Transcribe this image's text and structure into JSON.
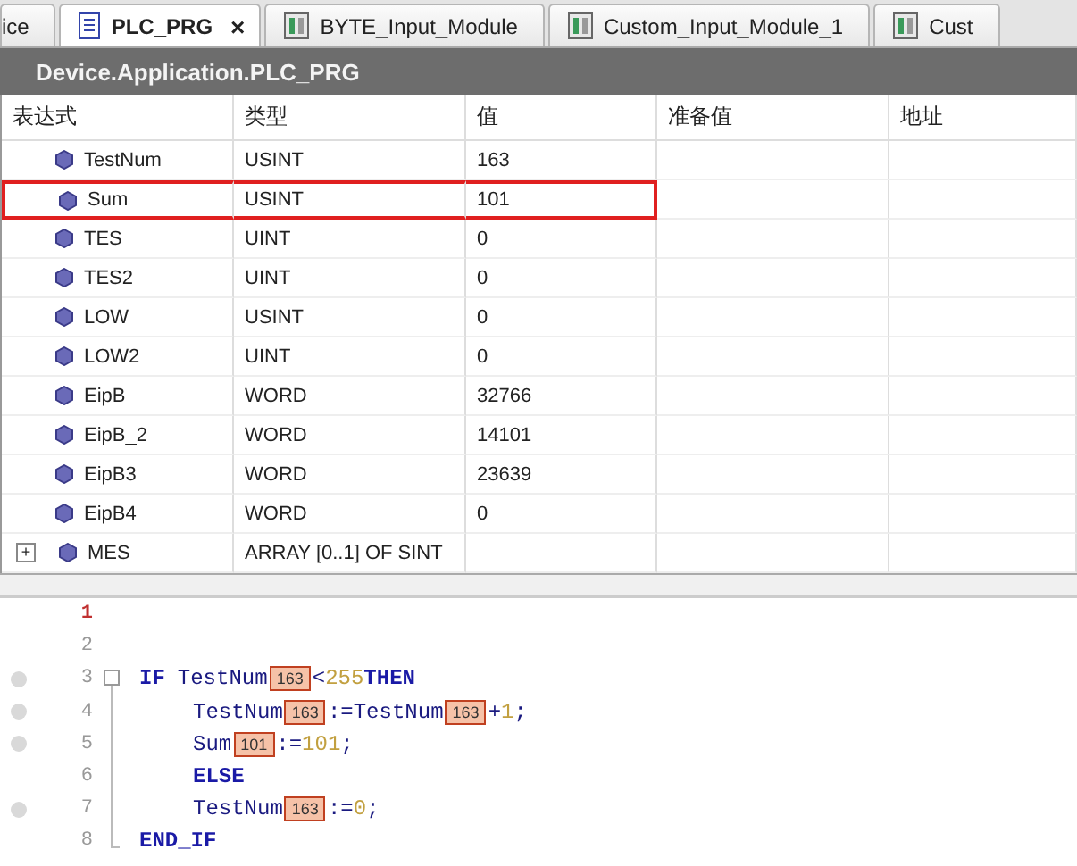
{
  "tabs": [
    {
      "label": "ice",
      "selected": false,
      "closable": false
    },
    {
      "label": "PLC_PRG",
      "selected": true,
      "closable": true,
      "close": "×"
    },
    {
      "label": "BYTE_Input_Module",
      "selected": false,
      "closable": false
    },
    {
      "label": "Custom_Input_Module_1",
      "selected": false,
      "closable": false
    },
    {
      "label": "Cust",
      "selected": false,
      "closable": false
    }
  ],
  "title": "Device.Application.PLC_PRG",
  "table": {
    "columns": [
      "表达式",
      "类型",
      "值",
      "准备值",
      "地址"
    ],
    "rows": [
      {
        "expression": "TestNum",
        "type": "USINT",
        "value": "163",
        "highlighted": false,
        "expandable": false
      },
      {
        "expression": "Sum",
        "type": "USINT",
        "value": "101",
        "highlighted": true,
        "expandable": false
      },
      {
        "expression": "TES",
        "type": "UINT",
        "value": "0",
        "highlighted": false,
        "expandable": false
      },
      {
        "expression": "TES2",
        "type": "UINT",
        "value": "0",
        "highlighted": false,
        "expandable": false
      },
      {
        "expression": "LOW",
        "type": "USINT",
        "value": "0",
        "highlighted": false,
        "expandable": false
      },
      {
        "expression": "LOW2",
        "type": "UINT",
        "value": "0",
        "highlighted": false,
        "expandable": false
      },
      {
        "expression": "EipB",
        "type": "WORD",
        "value": "32766",
        "highlighted": false,
        "expandable": false
      },
      {
        "expression": "EipB_2",
        "type": "WORD",
        "value": "14101",
        "highlighted": false,
        "expandable": false
      },
      {
        "expression": "EipB3",
        "type": "WORD",
        "value": "23639",
        "highlighted": false,
        "expandable": false
      },
      {
        "expression": "EipB4",
        "type": "WORD",
        "value": "0",
        "highlighted": false,
        "expandable": false
      },
      {
        "expression": "MES",
        "type": "ARRAY [0..1] OF SINT",
        "value": "",
        "highlighted": false,
        "expandable": true,
        "expander": "+"
      }
    ]
  },
  "editor": {
    "lines": [
      {
        "number": "1",
        "current": true,
        "breakpoint_marker": false,
        "kind": "plain"
      },
      {
        "number": "2",
        "current": false,
        "breakpoint_marker": false,
        "kind": "plain"
      },
      {
        "number": "3",
        "current": false,
        "breakpoint_marker": true,
        "kind": "fold_start",
        "tokens": [
          {
            "kind": "keyword",
            "text": "IF"
          },
          {
            "kind": "ident",
            "text": "TestNum"
          },
          {
            "kind": "monitor",
            "text": "163"
          },
          {
            "kind": "op",
            "text": "<"
          },
          {
            "kind": "number",
            "text": "255"
          },
          {
            "kind": "keyword",
            "text": "THEN"
          }
        ],
        "children": [
          {
            "number": "4",
            "current": false,
            "breakpoint_marker": true,
            "kind": "fold_body",
            "tokens": [
              {
                "kind": "ident",
                "text": "TestNum"
              },
              {
                "kind": "monitor",
                "text": "163"
              },
              {
                "kind": "op",
                "text": ":="
              },
              {
                "kind": "ident",
                "text": "TestNum"
              },
              {
                "kind": "monitor",
                "text": "163"
              },
              {
                "kind": "op",
                "text": "+"
              },
              {
                "kind": "number",
                "text": "1"
              },
              {
                "kind": "op",
                "text": ";"
              }
            ]
          },
          {
            "number": "5",
            "current": false,
            "breakpoint_marker": true,
            "kind": "fold_body",
            "tokens": [
              {
                "kind": "ident",
                "text": "Sum"
              },
              {
                "kind": "monitor",
                "text": "101"
              },
              {
                "kind": "op",
                "text": ":="
              },
              {
                "kind": "number",
                "text": "101"
              },
              {
                "kind": "op",
                "text": ";"
              }
            ]
          },
          {
            "number": "6",
            "current": false,
            "breakpoint_marker": false,
            "kind": "fold_body",
            "tokens": [
              {
                "kind": "keyword",
                "text": "ELSE"
              }
            ]
          },
          {
            "number": "7",
            "current": false,
            "breakpoint_marker": true,
            "kind": "fold_body",
            "tokens": [
              {
                "kind": "ident",
                "text": "TestNum"
              },
              {
                "kind": "monitor",
                "text": "163"
              },
              {
                "kind": "op",
                "text": ":="
              },
              {
                "kind": "number",
                "text": "0"
              },
              {
                "kind": "op",
                "text": ";"
              }
            ]
          }
        ]
      },
      {
        "number": "8",
        "current": false,
        "breakpoint_marker": false,
        "kind": "fold_end",
        "tokens": [
          {
            "kind": "keyword",
            "text": "END_IF"
          }
        ]
      }
    ]
  }
}
